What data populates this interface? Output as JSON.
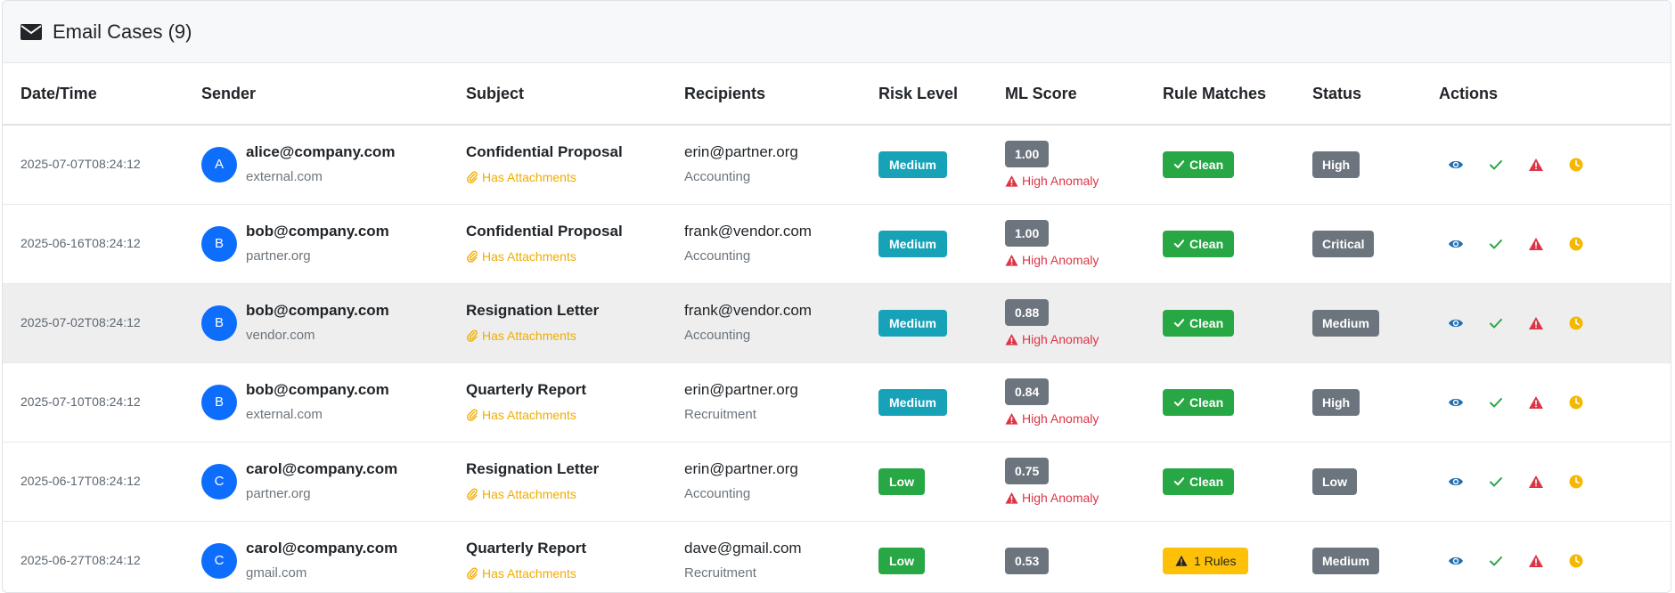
{
  "header": {
    "title": "Email Cases (9)",
    "icon": "envelope-icon"
  },
  "columns": [
    "Date/Time",
    "Sender",
    "Subject",
    "Recipients",
    "Risk Level",
    "ML Score",
    "Rule Matches",
    "Status",
    "Actions"
  ],
  "colors": {
    "avatar": "#0d6efd",
    "medium": "#17a2b8",
    "low": "#28a745",
    "gray": "#6c757d",
    "clean": "#28a745",
    "rules": "#ffc107",
    "anomaly": "#dc3545",
    "attach": "#f0ad00"
  },
  "rows": [
    {
      "datetime": "2025-07-07T08:24:12",
      "avatar": "A",
      "sender_email": "alice@company.com",
      "sender_domain": "external.com",
      "subject": "Confidential Proposal",
      "attachment": "Has Attachments",
      "recipient": "erin@partner.org",
      "department": "Accounting",
      "risk": "Medium",
      "ml_score": "1.00",
      "anomaly": "High Anomaly",
      "rule": "Clean",
      "status": "High"
    },
    {
      "datetime": "2025-06-16T08:24:12",
      "avatar": "B",
      "sender_email": "bob@company.com",
      "sender_domain": "partner.org",
      "subject": "Confidential Proposal",
      "attachment": "Has Attachments",
      "recipient": "frank@vendor.com",
      "department": "Accounting",
      "risk": "Medium",
      "ml_score": "1.00",
      "anomaly": "High Anomaly",
      "rule": "Clean",
      "status": "Critical"
    },
    {
      "datetime": "2025-07-02T08:24:12",
      "avatar": "B",
      "sender_email": "bob@company.com",
      "sender_domain": "vendor.com",
      "subject": "Resignation Letter",
      "attachment": "Has Attachments",
      "recipient": "frank@vendor.com",
      "department": "Accounting",
      "risk": "Medium",
      "ml_score": "0.88",
      "anomaly": "High Anomaly",
      "rule": "Clean",
      "status": "Medium"
    },
    {
      "datetime": "2025-07-10T08:24:12",
      "avatar": "B",
      "sender_email": "bob@company.com",
      "sender_domain": "external.com",
      "subject": "Quarterly Report",
      "attachment": "Has Attachments",
      "recipient": "erin@partner.org",
      "department": "Recruitment",
      "risk": "Medium",
      "ml_score": "0.84",
      "anomaly": "High Anomaly",
      "rule": "Clean",
      "status": "High"
    },
    {
      "datetime": "2025-06-17T08:24:12",
      "avatar": "C",
      "sender_email": "carol@company.com",
      "sender_domain": "partner.org",
      "subject": "Resignation Letter",
      "attachment": "Has Attachments",
      "recipient": "erin@partner.org",
      "department": "Accounting",
      "risk": "Low",
      "ml_score": "0.75",
      "anomaly": "High Anomaly",
      "rule": "Clean",
      "status": "Low"
    },
    {
      "datetime": "2025-06-27T08:24:12",
      "avatar": "C",
      "sender_email": "carol@company.com",
      "sender_domain": "gmail.com",
      "subject": "Quarterly Report",
      "attachment": "Has Attachments",
      "recipient": "dave@gmail.com",
      "department": "Recruitment",
      "risk": "Low",
      "ml_score": "0.53",
      "anomaly": "",
      "rule": "1 Rules",
      "status": "Medium"
    }
  ],
  "actions": [
    {
      "icon": "eye-icon",
      "color": "#1f6fb2"
    },
    {
      "icon": "check-icon",
      "color": "#28a745"
    },
    {
      "icon": "warning-icon",
      "color": "#dc3545"
    },
    {
      "icon": "clock-icon",
      "color": "#f5b800"
    }
  ]
}
